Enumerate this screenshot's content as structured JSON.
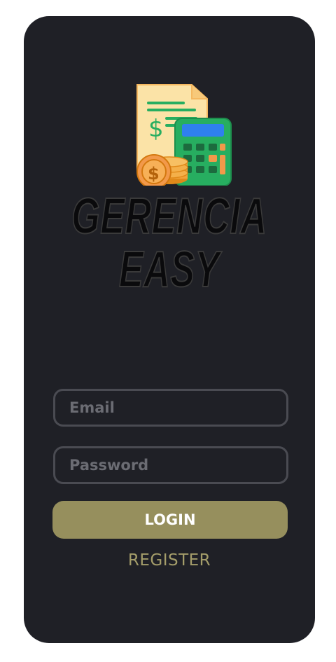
{
  "app": {
    "brand_line_1": "GERENCIA",
    "brand_line_2": "EASY",
    "logo_icon": "finance-calculator-icon"
  },
  "form": {
    "email": {
      "placeholder": "Email",
      "value": ""
    },
    "password": {
      "placeholder": "Password",
      "value": ""
    },
    "login_label": "LOGIN",
    "register_label": "REGISTER"
  },
  "colors": {
    "background": "#1f2026",
    "accent": "#968f5d",
    "register_text": "#a49d6a",
    "field_border": "#4a4b52"
  }
}
